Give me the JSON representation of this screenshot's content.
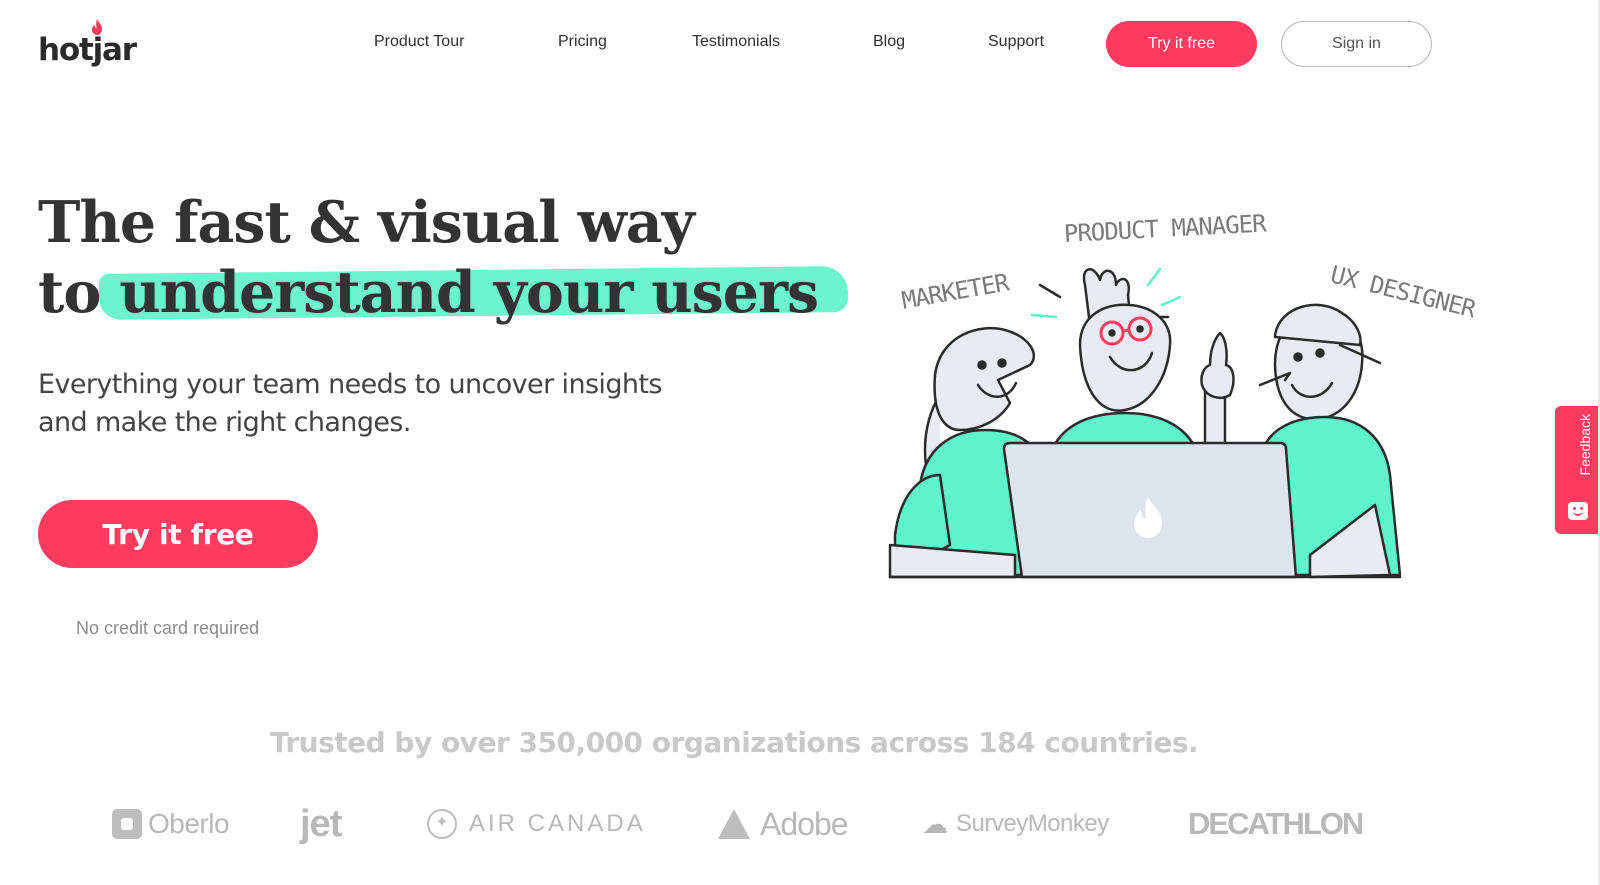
{
  "brand": {
    "logo_text": "hotjar",
    "accent_color": "#ff3c5f",
    "highlight_color": "#5ef3c8"
  },
  "nav": {
    "items": [
      "Product Tour",
      "Pricing",
      "Testimonials",
      "Blog",
      "Support"
    ],
    "try_free": "Try it free",
    "sign_in": "Sign in"
  },
  "hero": {
    "headline_line1": "The fast & visual way",
    "headline_line2_prefix": "to",
    "headline_line2_highlight": "understand your users",
    "subheadline": "Everything your team needs to uncover insights and make the right changes.",
    "cta": "Try it free",
    "note": "No credit card required"
  },
  "illustration": {
    "roles": [
      "MARKETER",
      "PRODUCT MANAGER",
      "UX DESIGNER"
    ],
    "icons": [
      "flame-icon"
    ]
  },
  "trusted": {
    "text": "Trusted by over 350,000 organizations across 184 countries.",
    "logos": [
      "Oberlo",
      "jet",
      "AIR CANADA",
      "Adobe",
      "SurveyMonkey",
      "DECATHLON"
    ]
  },
  "feedback": {
    "label": "Feedback"
  }
}
